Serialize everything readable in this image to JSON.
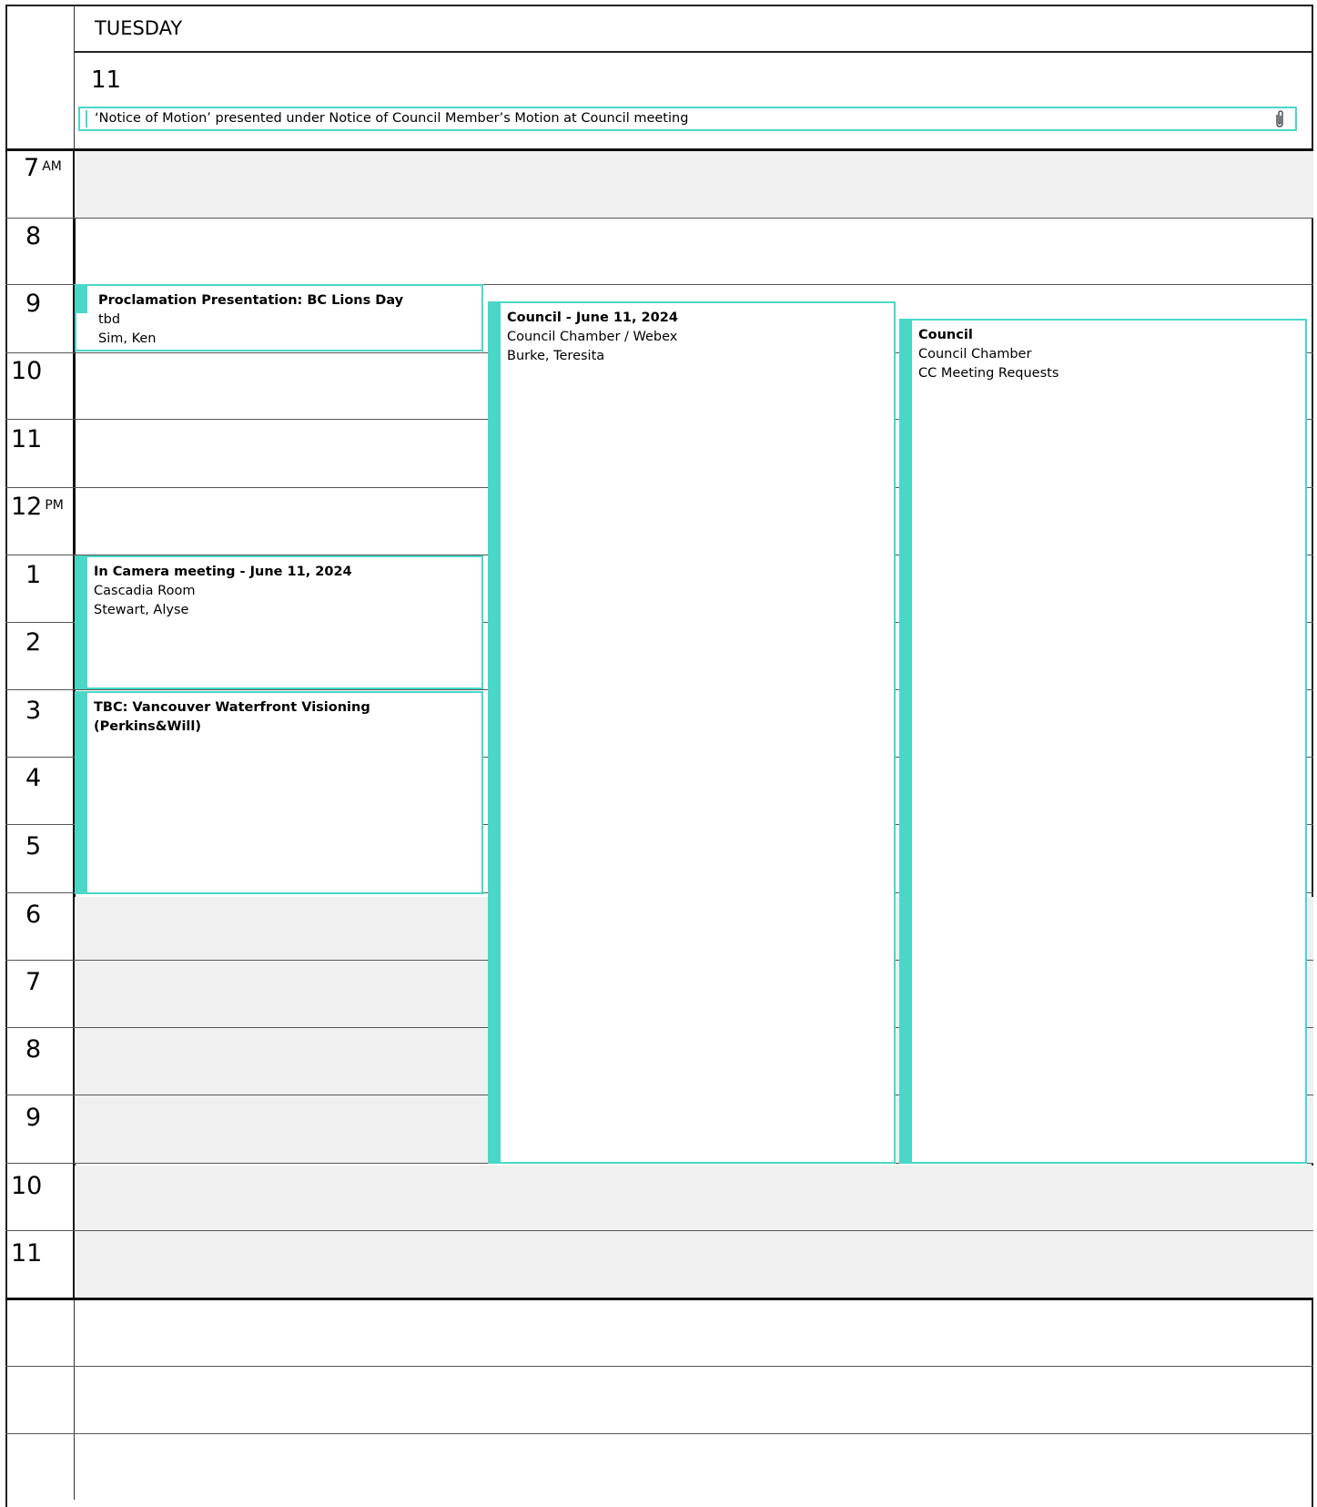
{
  "header": {
    "day_name": "TUESDAY",
    "date": "11",
    "all_day_event": {
      "title": "‘Notice of Motion’ presented under Notice of Council Member’s Motion at Council meeting",
      "icon": "paperclip-icon"
    }
  },
  "hours": [
    {
      "label": "7",
      "period": "AM"
    },
    {
      "label": "8",
      "period": ""
    },
    {
      "label": "9",
      "period": ""
    },
    {
      "label": "10",
      "period": ""
    },
    {
      "label": "11",
      "period": ""
    },
    {
      "label": "12",
      "period": "PM"
    },
    {
      "label": "1",
      "period": ""
    },
    {
      "label": "2",
      "period": ""
    },
    {
      "label": "3",
      "period": ""
    },
    {
      "label": "4",
      "period": ""
    },
    {
      "label": "5",
      "period": ""
    },
    {
      "label": "6",
      "period": ""
    },
    {
      "label": "7",
      "period": ""
    },
    {
      "label": "8",
      "period": ""
    },
    {
      "label": "9",
      "period": ""
    },
    {
      "label": "10",
      "period": ""
    },
    {
      "label": "11",
      "period": ""
    }
  ],
  "events": [
    {
      "title": "Proclamation Presentation: BC Lions Day",
      "location": "tbd",
      "organizer": "Sim, Ken",
      "start": "9:00 AM",
      "end": "10:00 AM"
    },
    {
      "title": "Council - June 11, 2024",
      "location": "Council Chamber / Webex",
      "organizer": "Burke, Teresita",
      "start": "9:15 AM",
      "end": "10:00 PM"
    },
    {
      "title": "Council",
      "location": "Council Chamber",
      "organizer": "CC Meeting Requests",
      "start": "9:30 AM",
      "end": "10:00 PM"
    },
    {
      "title": "In Camera meeting - June 11, 2024",
      "location": "Cascadia Room",
      "organizer": "Stewart, Alyse",
      "start": "1:00 PM",
      "end": "3:00 PM"
    },
    {
      "title": "TBC: Vancouver Waterfront Visioning (Perkins&Will)",
      "location": "",
      "organizer": "",
      "start": "3:00 PM",
      "end": "6:00 PM"
    }
  ],
  "colors": {
    "event_accent": "#49d7c8",
    "off_hours_band": "#f0f0f0",
    "grid_line": "#555555"
  }
}
